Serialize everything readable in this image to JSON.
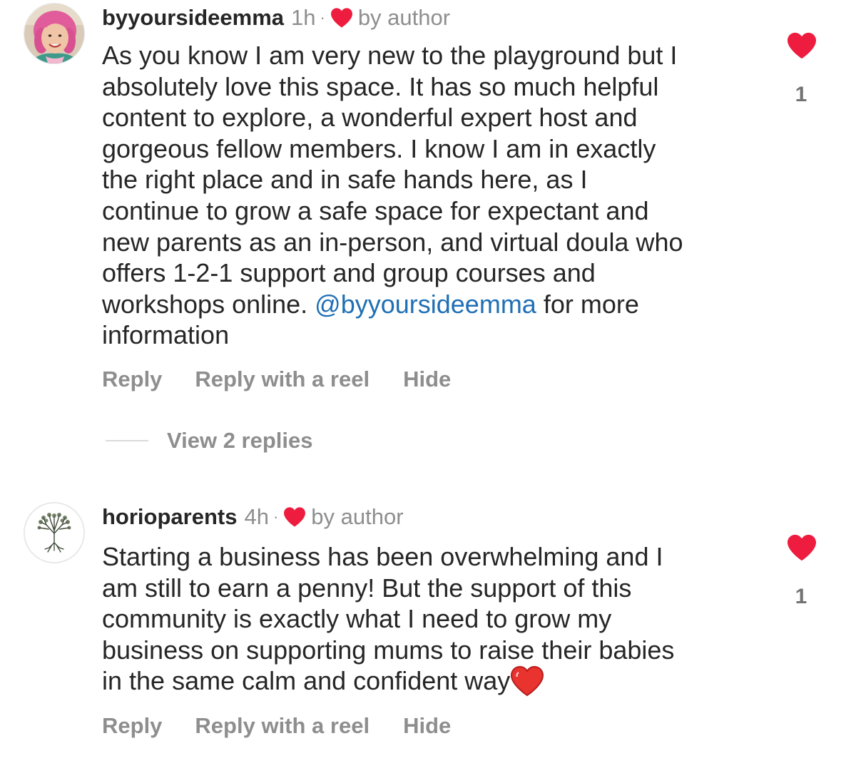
{
  "colors": {
    "heart_red": "#ee1d3f",
    "meta_gray": "#8e8e8e",
    "mention_blue": "#1e6fb4",
    "text": "#262626"
  },
  "comments": [
    {
      "username": "byyoursideemma",
      "time": "1h",
      "separator": "·",
      "badge_icon": "red-heart-icon",
      "badge_label": "by author",
      "avatar_icon": "profile-photo",
      "text_before": "As you know I am very new to the playground but I\nabsolutely love this space.  It has so much helpful\ncontent to explore, a wonderful expert host and\ngorgeous fellow members. I know I am in exactly\nthe right place and in safe hands here, as I\ncontinue to grow a safe space for expectant and\nnew parents as an in-person, and virtual doula who\noffers 1-2-1 support and group courses and\nworkshops online. ",
      "mention": "@byyoursideemma",
      "text_after": "  for more\ninformation",
      "like_icon": "red-heart-icon",
      "like_count": "1",
      "actions": {
        "reply": "Reply",
        "reply_reel": "Reply with a reel",
        "hide": "Hide"
      },
      "view_replies": "View 2 replies"
    },
    {
      "username": "horioparents",
      "time": "4h",
      "separator": "·",
      "badge_icon": "red-heart-icon",
      "badge_label": "by author",
      "avatar_icon": "tree-logo",
      "text": "Starting a business has been overwhelming and I\nam still to earn a penny! But the support of this\ncommunity is exactly what I need to grow my\nbusiness on supporting mums to raise their babies\nin the same calm and confident way",
      "emoji": "red-heart-emoji",
      "like_icon": "red-heart-icon",
      "like_count": "1",
      "actions": {
        "reply": "Reply",
        "reply_reel": "Reply with a reel",
        "hide": "Hide"
      }
    }
  ]
}
